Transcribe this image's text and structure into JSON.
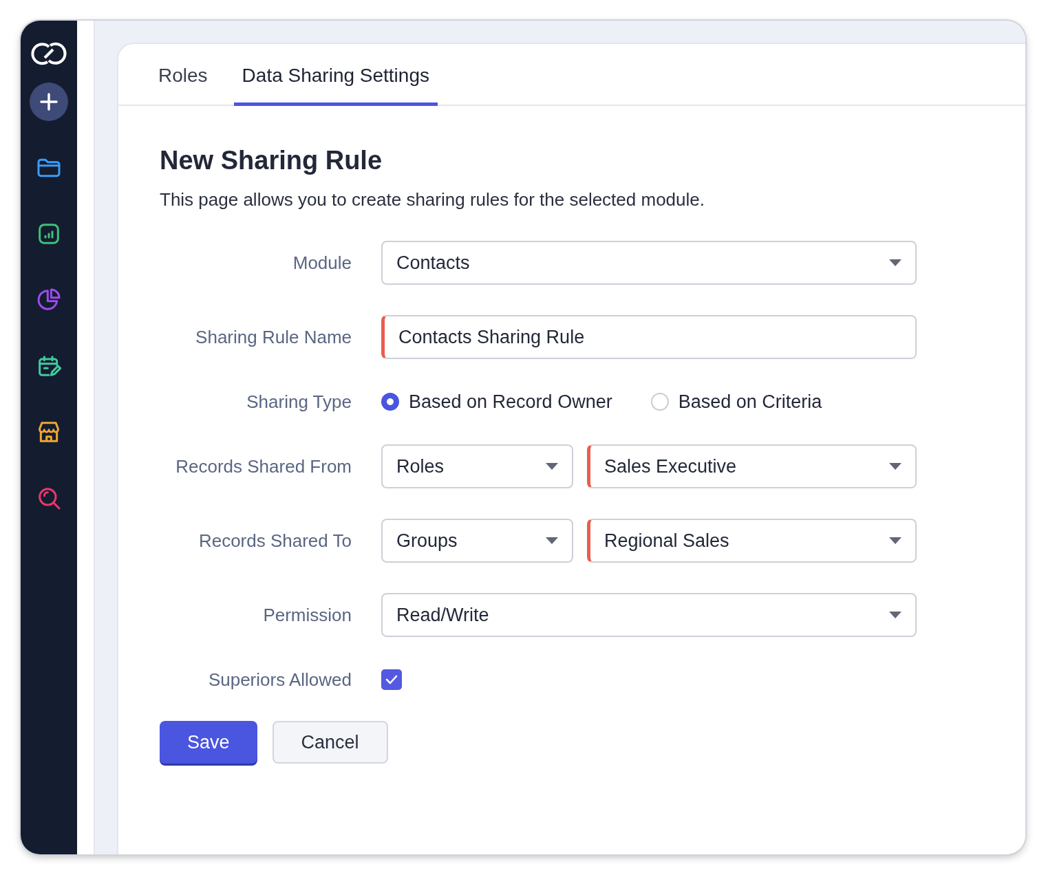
{
  "tabs": [
    {
      "label": "Roles",
      "selected": false
    },
    {
      "label": "Data Sharing Settings",
      "selected": true
    }
  ],
  "form": {
    "title": "New Sharing Rule",
    "description": "This page allows you to create sharing rules for the selected module.",
    "fields": [
      {
        "kind": "select",
        "label": "Module",
        "controls": [
          {
            "value": "Contacts",
            "required": false
          }
        ]
      },
      {
        "kind": "text",
        "label": "Sharing Rule Name",
        "controls": [
          {
            "value": "Contacts Sharing Rule",
            "required": true
          }
        ]
      },
      {
        "kind": "radio",
        "label": "Sharing Type",
        "options": [
          {
            "label": "Based on Record Owner",
            "selected": true
          },
          {
            "label": "Based on Criteria",
            "selected": false
          }
        ]
      },
      {
        "kind": "select",
        "label": "Records Shared From",
        "controls": [
          {
            "value": "Roles",
            "required": false
          },
          {
            "value": "Sales Executive",
            "required": true
          }
        ]
      },
      {
        "kind": "select",
        "label": "Records Shared To",
        "controls": [
          {
            "value": "Groups",
            "required": false
          },
          {
            "value": "Regional Sales",
            "required": true
          }
        ]
      },
      {
        "kind": "select",
        "label": "Permission",
        "controls": [
          {
            "value": "Read/Write",
            "required": false
          }
        ]
      },
      {
        "kind": "checkbox",
        "label": "Superiors Allowed",
        "checked": true
      }
    ],
    "buttons": [
      {
        "label": "Save",
        "kind": "primary"
      },
      {
        "label": "Cancel",
        "kind": "secondary"
      }
    ]
  }
}
